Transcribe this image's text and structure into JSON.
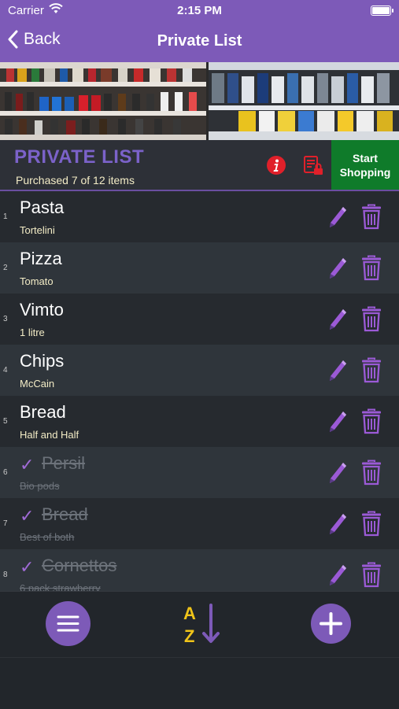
{
  "status_bar": {
    "carrier": "Carrier",
    "time": "2:15 PM"
  },
  "nav": {
    "back_label": "Back",
    "title": "Private List"
  },
  "list_header": {
    "title": "PRIVATE LIST",
    "subtitle": "Purchased 7 of 12 items",
    "start_button": "Start Shopping"
  },
  "items": [
    {
      "index": "1",
      "name": "Pasta",
      "note": "Tortelini",
      "purchased": false
    },
    {
      "index": "2",
      "name": "Pizza",
      "note": "Tomato",
      "purchased": false
    },
    {
      "index": "3",
      "name": "Vimto",
      "note": "1 litre",
      "purchased": false
    },
    {
      "index": "4",
      "name": "Chips",
      "note": "McCain",
      "purchased": false
    },
    {
      "index": "5",
      "name": "Bread",
      "note": "Half and Half",
      "purchased": false
    },
    {
      "index": "6",
      "name": "Persil",
      "note": "Bio pods",
      "purchased": true
    },
    {
      "index": "7",
      "name": "Bread",
      "note": "Best of both",
      "purchased": true
    },
    {
      "index": "8",
      "name": "Cornettos",
      "note": "6 pack strawberry",
      "purchased": true
    }
  ],
  "icons": {
    "back": "chevron-left-icon",
    "wifi": "wifi-icon",
    "battery": "battery-icon",
    "info": "info-icon",
    "lock": "list-lock-icon",
    "edit": "pencil-icon",
    "delete": "trash-icon",
    "check": "checkmark-icon",
    "menu": "menu-icon",
    "sort": "sort-az-icon",
    "add": "plus-icon"
  },
  "colors": {
    "accent": "#7d5ab8",
    "start_button": "#0f7b2a",
    "info_red": "#e0202a",
    "note_text": "#f3ecc6"
  }
}
